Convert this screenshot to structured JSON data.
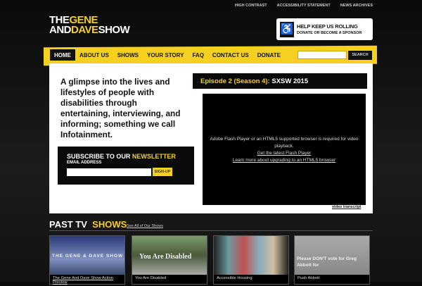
{
  "top_links": [
    "HIGH CONTRAST",
    "ACCESSIBILITY STATEMENT",
    "NEWS ARCHIVES"
  ],
  "logo": {
    "the": "THE",
    "gene": "GENE",
    "and": "AND",
    "dave": "DAVE",
    "show": "SHOW"
  },
  "sponsor": {
    "title": "HELP KEEP US ROLLING",
    "subtitle": "DONATE OR BECOME A SPONSOR"
  },
  "nav": [
    "HOME",
    "ABOUT US",
    "SHOWS",
    "YOUR STORY",
    "FAQ",
    "CONTACT US",
    "DONATE"
  ],
  "search": {
    "button": "SEARCH",
    "value": ""
  },
  "intro": "A glimpse into the lives and lifestyles of people with disabilities through entertaining, interviewing, and informing; something we call Infotainment.",
  "newsletter": {
    "title_white": "SUBSCRIBE TO OUR",
    "title_yellow": "NEWSLETTER",
    "label": "EMAIL ADDRESS",
    "button": "SIGN-UP"
  },
  "episode": {
    "prefix": "Episode 2 (Season 4):",
    "title": "SXSW 2015"
  },
  "video": {
    "message": "Adobe Flash Player or an HTML5 supported browser is required for video playback.",
    "link1": "Get the latest Flash Player",
    "link2": "Learn more about upgrading to an HTML5 browser",
    "transcript": "video transcript"
  },
  "past": {
    "white": "PAST TV",
    "yellow": "SHOWS",
    "see_all": "See All of Our Shows",
    "shows": [
      {
        "caption": "The Gene And Dave Show Action Preview",
        "overlay": "THE GENE & DAVE SHOW"
      },
      {
        "caption": "You Are Disabled",
        "overlay": "You Are Disabled"
      },
      {
        "caption": "Accessible Housing",
        "overlay": ""
      },
      {
        "caption": "Push Abbott",
        "overlay": "Please DON'T vote for Greg Abbott for"
      }
    ]
  }
}
